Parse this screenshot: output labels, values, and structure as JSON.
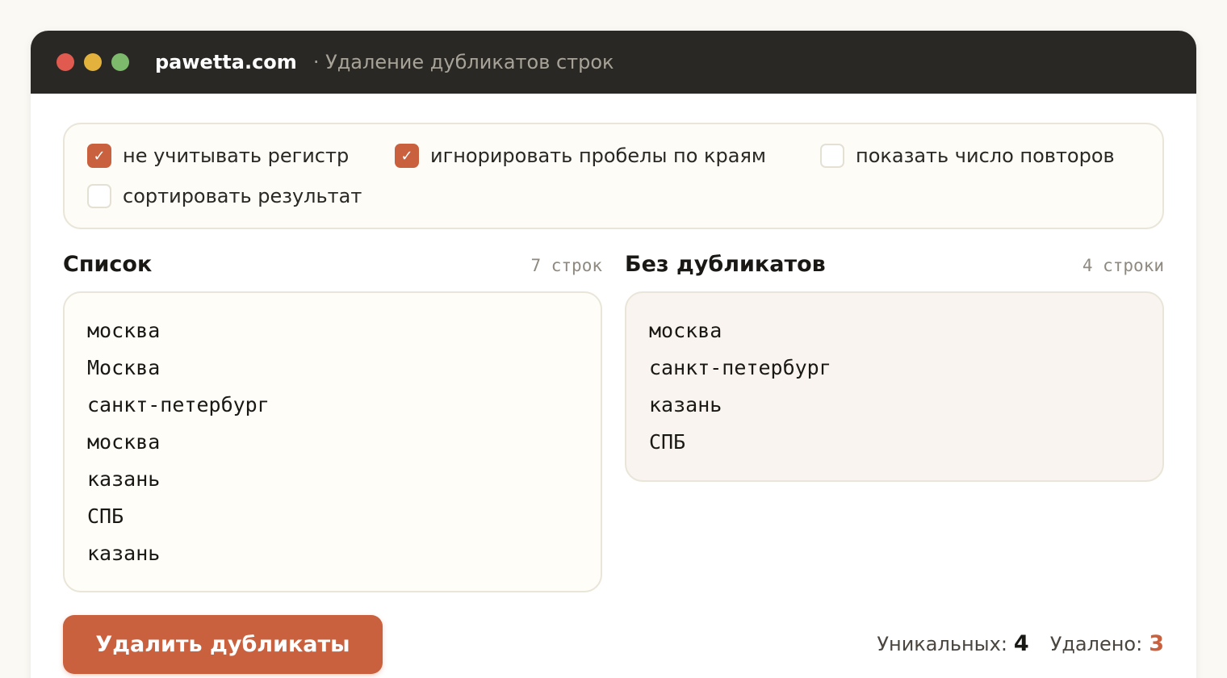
{
  "window": {
    "site": "pawetta.com",
    "subtitle": "· Удаление дубликатов строк"
  },
  "options": [
    {
      "label": "не учитывать регистр",
      "checked": true
    },
    {
      "label": "игнорировать пробелы по краям",
      "checked": true
    },
    {
      "label": "показать число повторов",
      "checked": false
    },
    {
      "label": "сортировать результат",
      "checked": false
    }
  ],
  "input": {
    "title": "Список",
    "count": "7 строк",
    "lines": [
      "москва",
      "Москва",
      "санкт-петербург",
      "москва",
      "казань",
      "СПБ",
      "казань"
    ]
  },
  "output": {
    "title": "Без дубликатов",
    "count": "4 строки",
    "lines": [
      "москва",
      "санкт-петербург",
      "казань",
      "СПБ"
    ]
  },
  "action": {
    "button_label": "Удалить дубликаты"
  },
  "stats": {
    "unique_label": "Уникальных:",
    "unique_value": "4",
    "removed_label": "Удалено:",
    "removed_value": "3"
  },
  "colors": {
    "accent": "#c9613f",
    "titlebar": "#2a2824"
  },
  "icons": {
    "check": "✓"
  }
}
